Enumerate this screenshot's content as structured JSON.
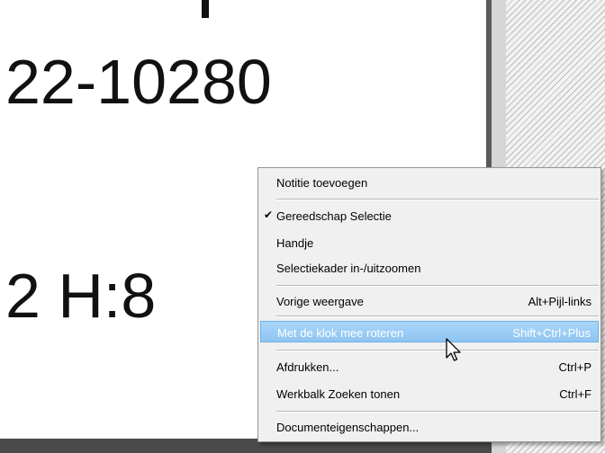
{
  "document": {
    "line1": "22-10280",
    "line2": "2 H:8"
  },
  "context_menu": {
    "items": [
      {
        "label": "Notitie toevoegen",
        "shortcut": "",
        "checked": false,
        "highlighted": false
      },
      {
        "label": "Gereedschap Selectie",
        "shortcut": "",
        "checked": true,
        "highlighted": false
      },
      {
        "label": "Handje",
        "shortcut": "",
        "checked": false,
        "highlighted": false
      },
      {
        "label": "Selectiekader in-/uitzoomen",
        "shortcut": "",
        "checked": false,
        "highlighted": false
      },
      {
        "label": "Vorige weergave",
        "shortcut": "Alt+Pijl-links",
        "checked": false,
        "highlighted": false
      },
      {
        "label": "Met de klok mee roteren",
        "shortcut": "Shift+Ctrl+Plus",
        "checked": false,
        "highlighted": true
      },
      {
        "label": "Afdrukken...",
        "shortcut": "Ctrl+P",
        "checked": false,
        "highlighted": false
      },
      {
        "label": "Werkbalk Zoeken tonen",
        "shortcut": "Ctrl+F",
        "checked": false,
        "highlighted": false
      },
      {
        "label": "Documenteigenschappen...",
        "shortcut": "",
        "checked": false,
        "highlighted": false
      }
    ],
    "check_glyph": "✔"
  },
  "colors": {
    "highlight": "#91c9f7",
    "menu_background": "#f0f0f0"
  },
  "icons": {
    "cursor": "mouse-pointer-icon"
  }
}
